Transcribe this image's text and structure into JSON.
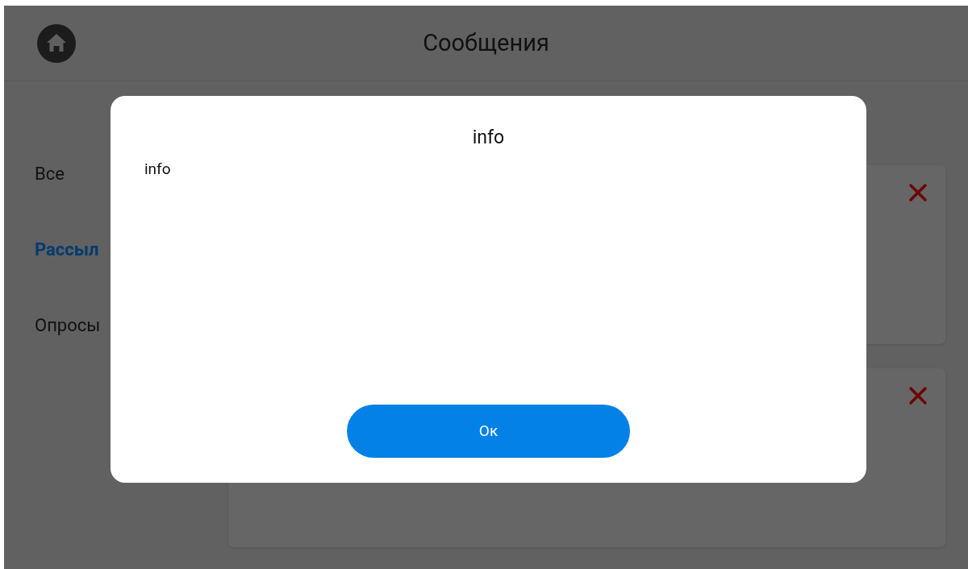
{
  "header": {
    "title": "Сообщения"
  },
  "sidebar": {
    "items": [
      {
        "label": "Все",
        "selected": false
      },
      {
        "label": "Рассыл",
        "selected": true
      },
      {
        "label": "Опросы",
        "selected": false
      }
    ]
  },
  "message_cards": [
    {
      "deletable": true
    },
    {
      "deletable": true
    }
  ],
  "dialog": {
    "title": "info",
    "message": "info",
    "button": "Ок"
  }
}
